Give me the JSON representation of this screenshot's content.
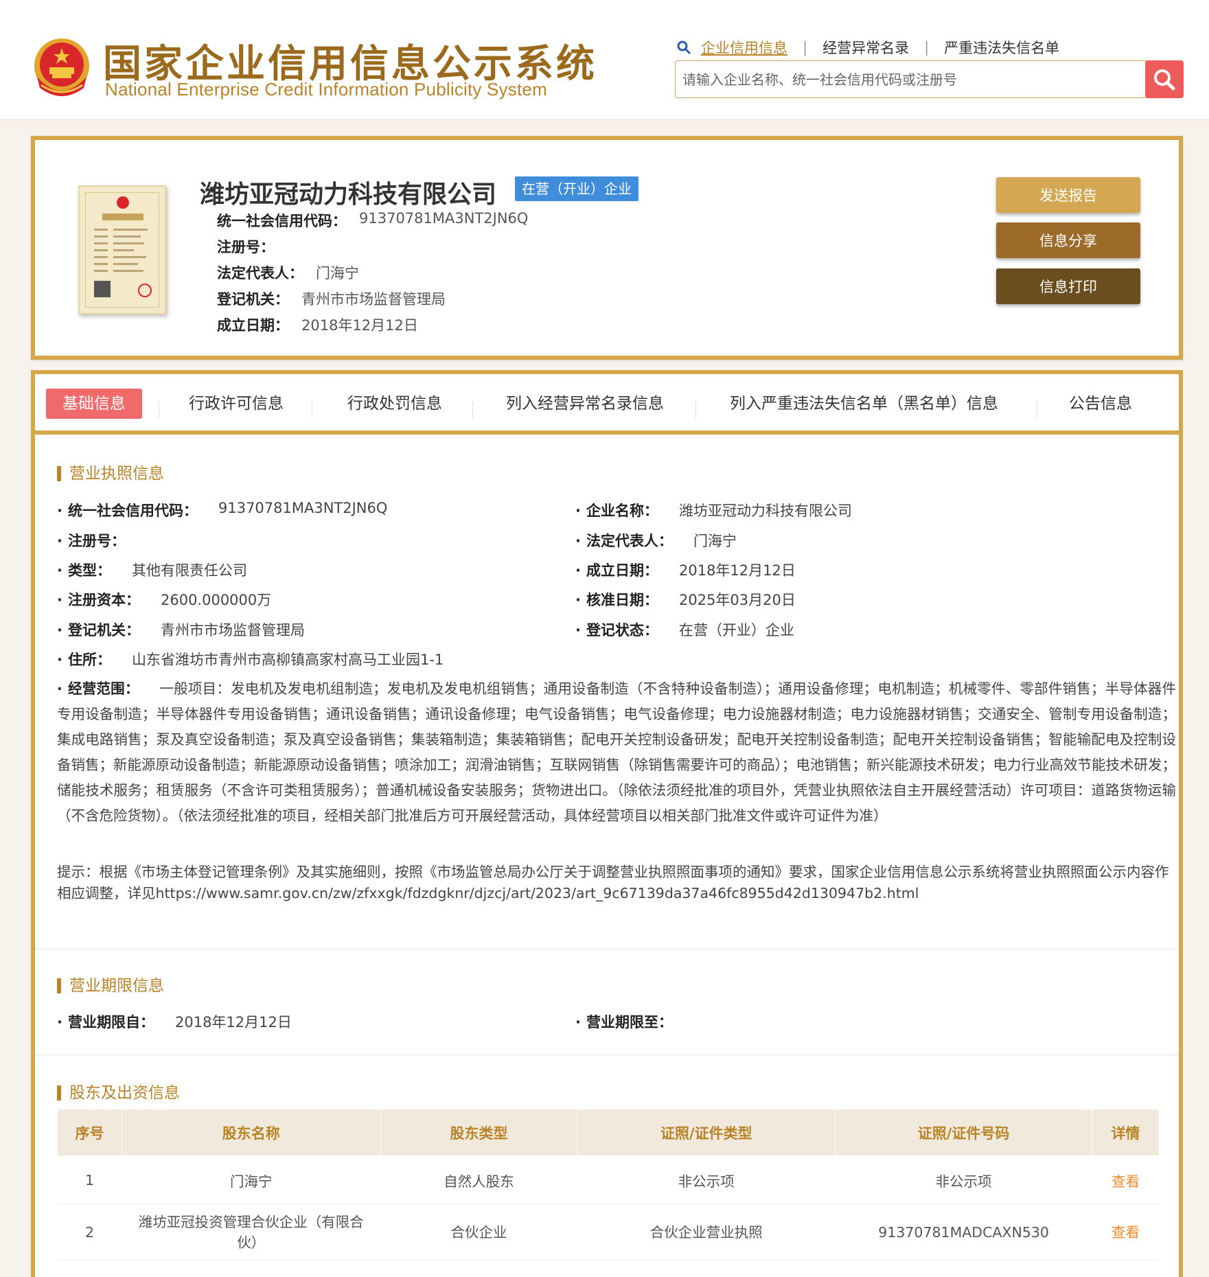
{
  "header": {
    "title_cn": "国家企业信用信息公示系统",
    "title_en": "National Enterprise Credit Information Publicity System",
    "nav": [
      {
        "label": "企业信用信息",
        "active": true
      },
      {
        "label": "经营异常名录",
        "active": false
      },
      {
        "label": "严重违法失信名单",
        "active": false
      }
    ],
    "search_placeholder": "请输入企业名称、统一社会信用代码或注册号"
  },
  "company": {
    "name": "潍坊亚冠动力科技有限公司",
    "status": "在营（开业）企业",
    "rows": [
      {
        "label": "统一社会信用代码：",
        "value": "91370781MA3NT2JN6Q"
      },
      {
        "label": "注册号：",
        "value": ""
      },
      {
        "label": "法定代表人：",
        "value": "门海宁"
      },
      {
        "label": "登记机关：",
        "value": "青州市市场监督管理局"
      },
      {
        "label": "成立日期：",
        "value": "2018年12月12日"
      }
    ],
    "buttons": {
      "report": "发送报告",
      "share": "信息分享",
      "print": "信息打印"
    }
  },
  "tabs": [
    "基础信息",
    "行政许可信息",
    "行政处罚信息",
    "列入经营异常名录信息",
    "列入严重违法失信名单（黑名单）信息",
    "公告信息"
  ],
  "license": {
    "title": "营业执照信息",
    "left": [
      {
        "label": "统一社会信用代码：",
        "value": "91370781MA3NT2JN6Q"
      },
      {
        "label": "注册号：",
        "value": ""
      },
      {
        "label": "类型：",
        "value": "其他有限责任公司"
      },
      {
        "label": "注册资本：",
        "value": "2600.000000万"
      },
      {
        "label": "登记机关：",
        "value": "青州市市场监督管理局"
      },
      {
        "label": "住所：",
        "value": "山东省潍坊市青州市高柳镇高家村高马工业园1-1"
      }
    ],
    "right": [
      {
        "label": "企业名称：",
        "value": "潍坊亚冠动力科技有限公司"
      },
      {
        "label": "法定代表人：",
        "value": "门海宁"
      },
      {
        "label": "成立日期：",
        "value": "2018年12月12日"
      },
      {
        "label": "核准日期：",
        "value": "2025年03月20日"
      },
      {
        "label": "登记状态：",
        "value": "在营（开业）企业"
      }
    ],
    "scope_label": "经营范围：",
    "scope_value": "一般项目：发电机及发电机组制造；发电机及发电机组销售；通用设备制造（不含特种设备制造）；通用设备修理；电机制造；机械零件、零部件销售；半导体器件专用设备制造；半导体器件专用设备销售；通讯设备销售；通讯设备修理；电气设备销售；电气设备修理；电力设施器材制造；电力设施器材销售；交通安全、管制专用设备制造；集成电路销售；泵及真空设备制造；泵及真空设备销售；集装箱制造；集装箱销售；配电开关控制设备研发；配电开关控制设备制造；配电开关控制设备销售；智能输配电及控制设备销售；新能源原动设备制造；新能源原动设备销售；喷涂加工；润滑油销售；互联网销售（除销售需要许可的商品）；电池销售；新兴能源技术研发；电力行业高效节能技术研发；储能技术服务；租赁服务（不含许可类租赁服务）；普通机械设备安装服务；货物进出口。（除依法须经批准的项目外，凭营业执照依法自主开展经营活动）许可项目：道路货物运输（不含危险货物）。（依法须经批准的项目，经相关部门批准后方可开展经营活动，具体经营项目以相关部门批准文件或许可证件为准）",
    "tip": "提示：根据《市场主体登记管理条例》及其实施细则，按照《市场监管总局办公厅关于调整营业执照照面事项的通知》要求，国家企业信用信息公示系统将营业执照照面公示内容作相应调整，详见https://www.samr.gov.cn/zw/zfxxgk/fdzdgknr/djzcj/art/2023/art_9c67139da37a46fc8955d42d130947b2.html"
  },
  "term": {
    "title": "营业期限信息",
    "from_label": "营业期限自：",
    "from_value": "2018年12月12日",
    "to_label": "营业期限至：",
    "to_value": ""
  },
  "shareholders": {
    "title": "股东及出资信息",
    "columns": [
      "序号",
      "股东名称",
      "股东类型",
      "证照/证件类型",
      "证照/证件号码",
      "详情"
    ],
    "rows": [
      [
        "1",
        "门海宁",
        "自然人股东",
        "非公示项",
        "非公示项",
        "查看"
      ],
      [
        "2",
        "潍坊亚冠投资管理合伙企业（有限合伙）",
        "合伙企业",
        "合伙企业营业执照",
        "91370781MADCAXN530",
        "查看"
      ]
    ]
  },
  "colors": {
    "gold": "#d4a84a",
    "accent": "#b98328",
    "red": "#ef6a6a",
    "blue": "#3f8ddb",
    "link": "#ec8b2e"
  }
}
